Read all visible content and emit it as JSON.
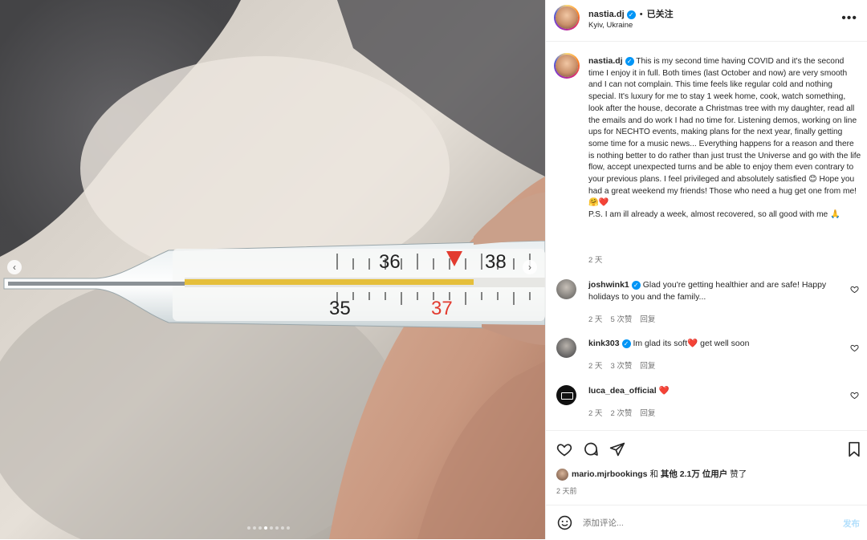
{
  "post": {
    "username": "nastia.dj",
    "follow_status": "已关注",
    "separator": "•",
    "location": "Kyiv, Ukraine",
    "more_icon": "more-horizontal-icon"
  },
  "caption": {
    "username": "nastia.dj",
    "text": "This is my second time having COVID and it's the second time I enjoy it in full. Both times (last October and now) are very smooth and I can not complain. This time feels like regular cold and nothing special. It's luxury for me to stay 1 week home, cook, watch something, look after the house, decorate a Christmas tree with my daughter, read all the emails and do work I had no time for. Listening demos, working on line ups for NECHTO events, making plans for the next year, finally getting some time for a music news... Everything happens for a reason and there is nothing better to do rather than just trust the Universe and go with the life flow, accept unexpected turns and be able to enjoy them even contrary to your previous plans. I feel privileged and absolutely satisfied 😊 Hope you had a great weekend my friends! Those who need a hug get one from me! 🤗❤️",
    "ps": "P.S. I am ill already a week, almost recovered, so all good with me 🙏",
    "time": "2 天"
  },
  "comments": [
    {
      "username": "joshwink1",
      "verified": true,
      "text": "Glad you're getting healthier and are safe! Happy holidays to you and the family...",
      "time": "2 天",
      "likes": "5 次赞",
      "reply": "回复"
    },
    {
      "username": "kink303",
      "verified": true,
      "text": "Im glad its soft❤️ get well soon",
      "time": "2 天",
      "likes": "3 次赞",
      "reply": "回复"
    },
    {
      "username": "luca_dea_official",
      "verified": false,
      "text": "❤️",
      "time": "2 天",
      "likes": "2 次赞",
      "reply": "回复"
    }
  ],
  "actions": {
    "like_icon": "heart-outline-icon",
    "comment_icon": "comment-bubble-icon",
    "share_icon": "paper-plane-icon",
    "save_icon": "bookmark-icon"
  },
  "likes": {
    "user": "mario.mjrbookings",
    "and": "和",
    "others": "其他 2.1万 位用户",
    "liked": "赞了"
  },
  "post_time": "2 天前",
  "add_comment": {
    "placeholder": "添加评论...",
    "post_label": "发布",
    "emoji_icon": "emoji-smile-icon"
  },
  "media": {
    "thermometer_ticks_top": [
      "36",
      "38"
    ],
    "thermometer_ticks_bottom": [
      "35",
      "37"
    ],
    "carousel_count": 8,
    "carousel_active_index": 3
  },
  "colors": {
    "accent": "#0095f6",
    "heart": "#ed4956",
    "thermo_red": "#e23b2f"
  }
}
